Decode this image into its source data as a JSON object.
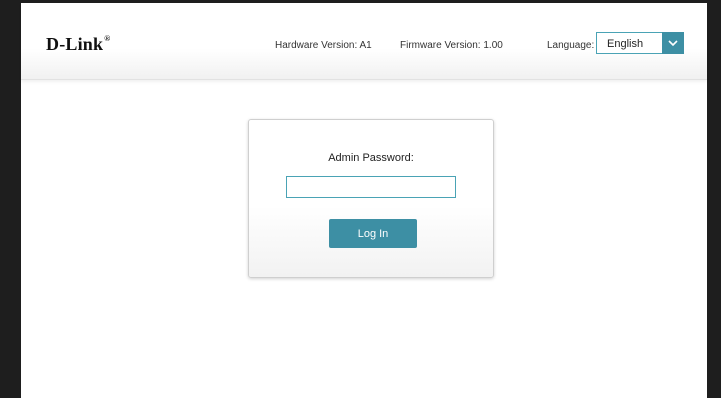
{
  "header": {
    "logo_text": "D-Link",
    "hardware_version": "Hardware Version: A1",
    "firmware_version": "Firmware Version: 1.00",
    "language_label": "Language:",
    "language_value": "English"
  },
  "login": {
    "password_label": "Admin Password:",
    "password_value": "",
    "login_button": "Log In"
  },
  "colors": {
    "accent": "#3d8fa4",
    "input_border": "#4aa3b5",
    "frame": "#1e1e1e"
  },
  "icons": {
    "language_dropdown": "chevron-down-icon"
  }
}
